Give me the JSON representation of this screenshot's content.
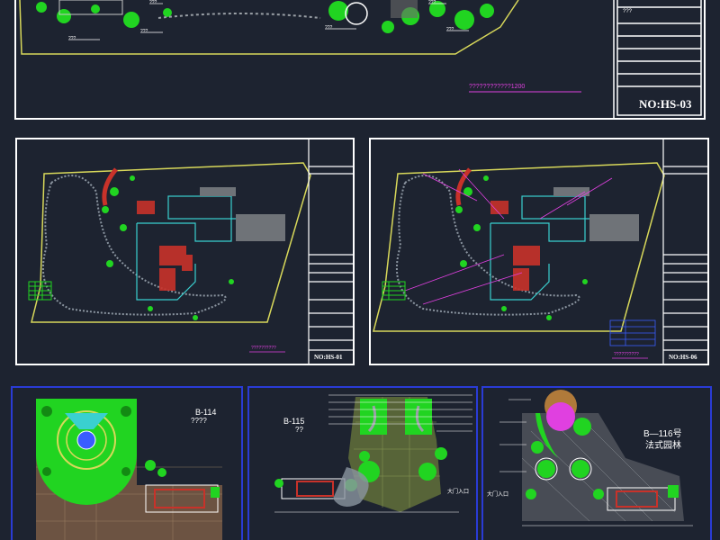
{
  "top_sheet": {
    "code": "NO:HS-03",
    "small_text": "???",
    "magenta_text": "????????????1200",
    "labels": [
      "???",
      "???",
      "???",
      "???",
      "???",
      "???"
    ]
  },
  "mid_left_sheet": {
    "code": "NO:HS-01",
    "magenta_text": "??????????"
  },
  "mid_right_sheet": {
    "code": "NO:HS-06",
    "magenta_text": "??????????"
  },
  "bottom_sheets": [
    {
      "title": "B-114",
      "subtitle": "????"
    },
    {
      "title": "B-115",
      "subtitle": "??",
      "entrance": "大门入口"
    },
    {
      "title": "B—116号",
      "subtitle": "法式园林",
      "entrance": "大门入口"
    }
  ],
  "colors": {
    "background": "#1d2330",
    "frame_white": "#ffffff",
    "frame_blue": "#2a3bd6",
    "cad_yellow": "#d8d85a",
    "cad_green": "#21d421",
    "cad_red": "#c8322a",
    "cad_magenta": "#e040e0",
    "cad_cyan": "#3ad0d0"
  }
}
